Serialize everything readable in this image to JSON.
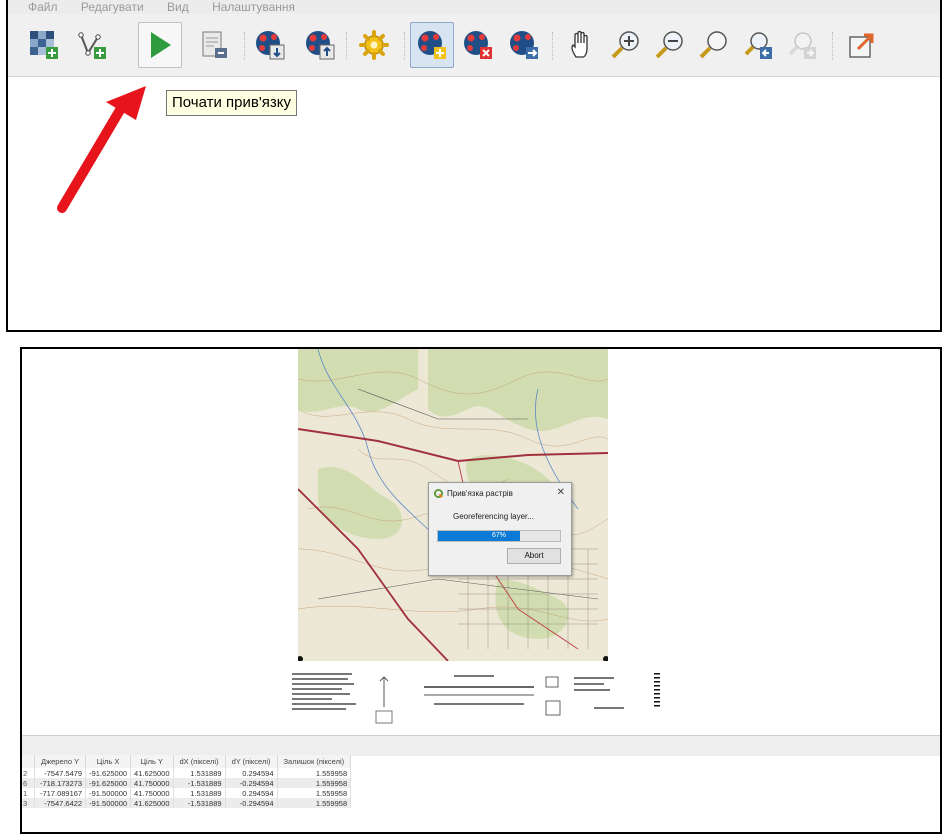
{
  "menubar": {
    "items": [
      "Файл",
      "Редагувати",
      "Вид",
      "Налаштування"
    ]
  },
  "toolbar": {
    "icons": [
      "open-raster-icon",
      "start-georeferencing-icon",
      "generate-gdal-script-icon",
      "load-gcp-icon",
      "save-gcp-icon",
      "transformation-settings-icon",
      "add-point-icon",
      "delete-point-icon",
      "move-gcp-icon",
      "pan-icon",
      "zoom-in-icon",
      "zoom-out-icon",
      "zoom-to-layer-icon",
      "zoom-last-icon",
      "zoom-next-icon",
      "link-georeferencer-icon"
    ],
    "tooltip": "Почати прив'язку",
    "accent": "#2e9b3e"
  },
  "annotation": {
    "arrow_color": "#e8141b"
  },
  "progress_dialog": {
    "title": "Прив'язка растрів",
    "message": "Georeferencing layer...",
    "progress_percent": 67,
    "progress_label": "67%",
    "abort_label": "Abort",
    "bar_color": "#0a7ad6"
  },
  "gcp_table": {
    "columns": [
      "Джерело Y",
      "Ціль X",
      "Ціль Y",
      "dX (пікселі)",
      "dY (пікселі)",
      "Залишок (пікселі)"
    ],
    "rows": [
      {
        "id": "2",
        "cells": [
          "-7547.5479",
          "-91.625000",
          "41.625000",
          "1.531889",
          "0.294594",
          "1.559958"
        ]
      },
      {
        "id": "6",
        "cells": [
          "-718.173273",
          "-91.625000",
          "41.750000",
          "-1.531889",
          "-0.294594",
          "1.559958"
        ]
      },
      {
        "id": "1",
        "cells": [
          "-717.089167",
          "-91.500000",
          "41.750000",
          "1.531889",
          "0.294594",
          "1.559958"
        ]
      },
      {
        "id": "3",
        "cells": [
          "-7547.6422",
          "-91.500000",
          "41.625000",
          "-1.531889",
          "-0.294594",
          "1.559958"
        ]
      }
    ]
  }
}
